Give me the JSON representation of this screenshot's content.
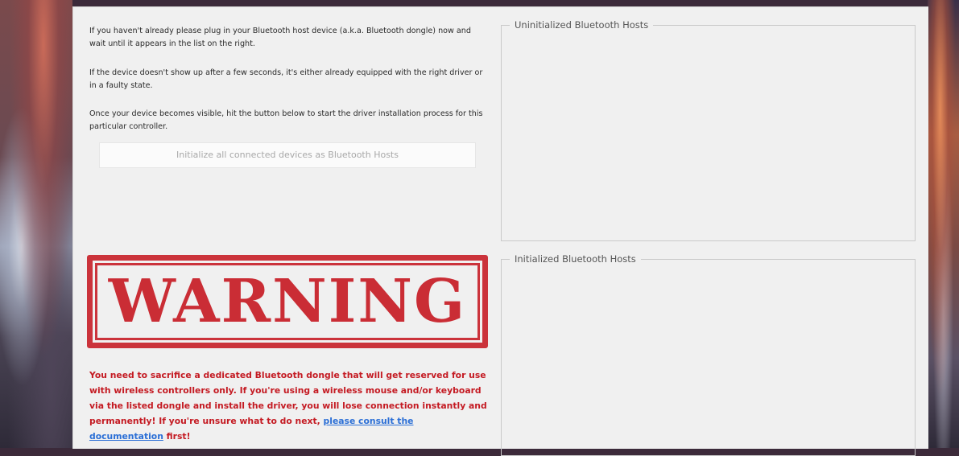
{
  "instructions": {
    "para1": "If you haven't already please plug in your Bluetooth host device (a.k.a. Bluetooth dongle) now and wait until it appears in the list on the right.",
    "para2": "If the device doesn't show up after a few seconds, it's either already equipped with the right driver or in a faulty state.",
    "para3": "Once your device becomes visible, hit the button below to start the driver installation process for this particular controller."
  },
  "init_button_label": "Initialize all connected devices as Bluetooth Hosts",
  "uninitialized_group_title": "Uninitialized Bluetooth Hosts",
  "initialized_group_title": "Initialized Bluetooth Hosts",
  "warning": {
    "stamp_text": "WARNING",
    "message_before_link": "You need to sacrifice a dedicated Bluetooth dongle that will get reserved for use with wireless controllers only. If you're using a wireless mouse and/or keyboard via the listed dongle and install the driver, you will lose connection instantly and permanently! If you're unsure what to do next, ",
    "link_text": "please consult the documentation",
    "message_after_link": " first!",
    "color": "#c41a22",
    "link_color": "#2b6fd6"
  }
}
